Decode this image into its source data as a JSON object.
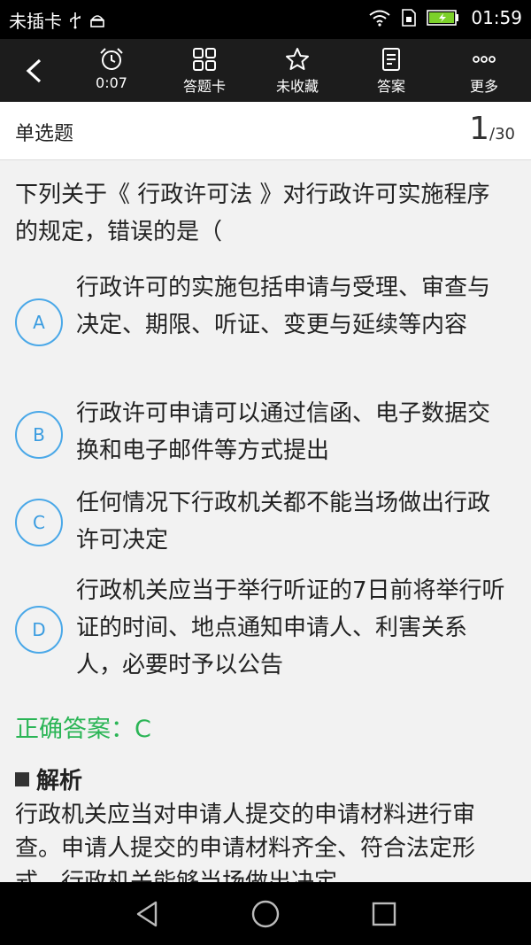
{
  "status_bar": {
    "carrier": "未插卡",
    "time": "01:59",
    "icons": [
      "usb-icon",
      "android-icon",
      "wifi-icon",
      "sim-icon",
      "battery-charging-icon"
    ]
  },
  "toolbar": {
    "items": [
      {
        "label": "0:07",
        "icon": "alarm-clock-icon"
      },
      {
        "label": "答题卡",
        "icon": "grid-icon"
      },
      {
        "label": "未收藏",
        "icon": "star-icon"
      },
      {
        "label": "答案",
        "icon": "document-icon"
      },
      {
        "label": "更多",
        "icon": "more-dots-icon"
      }
    ]
  },
  "header": {
    "question_type": "单选题",
    "current": "1",
    "total": "/30"
  },
  "question": {
    "text": "下列关于《 行政许可法 》对行政许可实施程序的规定，错误的是（",
    "options": [
      {
        "letter": "A",
        "text": "行政许可的实施包括申请与受理、审查与决定、期限、听证、变更与延续等内容"
      },
      {
        "letter": "B",
        "text": "行政许可申请可以通过信函、电子数据交换和电子邮件等方式提出"
      },
      {
        "letter": "C",
        "text": "任何情况下行政机关都不能当场做出行政许可决定"
      },
      {
        "letter": "D",
        "text": "行政机关应当于举行听证的7日前将举行听证的时间、地点通知申请人、利害关系人，必要时予以公告"
      }
    ],
    "answer_label": "正确答案：C",
    "analysis_title": "解析",
    "analysis_text": "行政机关应当对申请人提交的申请材料进行审查。申请人提交的申请材料齐全、符合法定形式，行政机关能够当场做出决定"
  },
  "colors": {
    "accent": "#4aa8e8",
    "correct": "#2bb556",
    "toolbar_bg": "#1c1c1c"
  }
}
